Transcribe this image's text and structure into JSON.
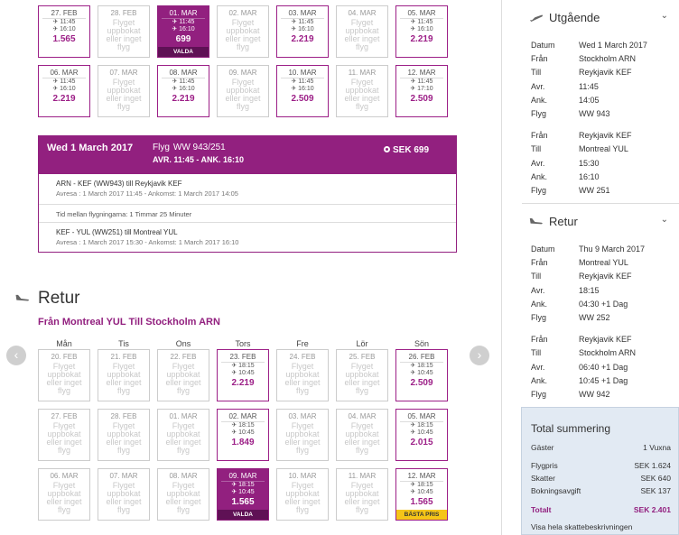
{
  "outbound_calendar": [
    {
      "date": "27. FEB",
      "t1": "11:45",
      "t2": "16:10",
      "price": "1.565",
      "state": "avail"
    },
    {
      "date": "28. FEB",
      "na": [
        "Flyget",
        "uppbokat",
        "eller inget",
        "flyg"
      ],
      "state": "na"
    },
    {
      "date": "01. MAR",
      "t1": "11:45",
      "t2": "16:10",
      "price": "699",
      "state": "sel",
      "tag": "VALDA"
    },
    {
      "date": "02. MAR",
      "na": [
        "Flyget",
        "uppbokat",
        "eller inget",
        "flyg"
      ],
      "state": "na"
    },
    {
      "date": "03. MAR",
      "t1": "11:45",
      "t2": "16:10",
      "price": "2.219",
      "state": "avail"
    },
    {
      "date": "04. MAR",
      "na": [
        "Flyget",
        "uppbokat",
        "eller inget",
        "flyg"
      ],
      "state": "na"
    },
    {
      "date": "05. MAR",
      "t1": "11:45",
      "t2": "16:10",
      "price": "2.219",
      "state": "avail"
    },
    {
      "date": "06. MAR",
      "t1": "11:45",
      "t2": "16:10",
      "price": "2.219",
      "state": "avail"
    },
    {
      "date": "07. MAR",
      "na": [
        "Flyget",
        "uppbokat",
        "eller inget",
        "flyg"
      ],
      "state": "na"
    },
    {
      "date": "08. MAR",
      "t1": "11:45",
      "t2": "16:10",
      "price": "2.219",
      "state": "avail"
    },
    {
      "date": "09. MAR",
      "na": [
        "Flyget",
        "uppbokat",
        "eller inget",
        "flyg"
      ],
      "state": "na"
    },
    {
      "date": "10. MAR",
      "t1": "11:45",
      "t2": "16:10",
      "price": "2.509",
      "state": "avail"
    },
    {
      "date": "11. MAR",
      "na": [
        "Flyget",
        "uppbokat",
        "eller inget",
        "flyg"
      ],
      "state": "na"
    },
    {
      "date": "12. MAR",
      "t1": "11:45",
      "t2": "17:10",
      "price": "2.509",
      "state": "avail"
    }
  ],
  "detail": {
    "date": "Wed 1 March 2017",
    "flyg_label": "Flyg",
    "flight": "WW 943/251",
    "times": "AVR. 11:45 - ANK. 16:10",
    "price": "SEK 699",
    "seg1_title": "ARN - KEF (WW943) till Reykjavik KEF",
    "seg1_times": "Avresa : 1 March 2017 11:45 - Ankomst: 1 March 2017 14:05",
    "gap": "Tid mellan flygningarna: 1 Timmar 25 Minuter",
    "seg2_title": "KEF - YUL (WW251) till Montreal YUL",
    "seg2_times": "Avresa : 1 March 2017 15:30 - Ankomst: 1 March 2017 16:10"
  },
  "retur": {
    "title": "Retur",
    "subtitle": "Från Montreal YUL Till Stockholm ARN",
    "weekdays": [
      "Mån",
      "Tis",
      "Ons",
      "Tors",
      "Fre",
      "Lör",
      "Sön"
    ]
  },
  "return_calendar": [
    {
      "date": "20. FEB",
      "na": [
        "Flyget",
        "uppbokat",
        "eller inget",
        "flyg"
      ],
      "state": "na"
    },
    {
      "date": "21. FEB",
      "na": [
        "Flyget",
        "uppbokat",
        "eller inget",
        "flyg"
      ],
      "state": "na"
    },
    {
      "date": "22. FEB",
      "na": [
        "Flyget",
        "uppbokat",
        "eller inget",
        "flyg"
      ],
      "state": "na"
    },
    {
      "date": "23. FEB",
      "t1": "18:15",
      "t2": "10:45",
      "price": "2.219",
      "state": "avail"
    },
    {
      "date": "24. FEB",
      "na": [
        "Flyget",
        "uppbokat",
        "eller inget",
        "flyg"
      ],
      "state": "na"
    },
    {
      "date": "25. FEB",
      "na": [
        "Flyget",
        "uppbokat",
        "eller inget",
        "flyg"
      ],
      "state": "na"
    },
    {
      "date": "26. FEB",
      "t1": "18:15",
      "t2": "10:45",
      "price": "2.509",
      "state": "avail"
    },
    {
      "date": "27. FEB",
      "na": [
        "Flyget",
        "uppbokat",
        "eller inget",
        "flyg"
      ],
      "state": "na"
    },
    {
      "date": "28. FEB",
      "na": [
        "Flyget",
        "uppbokat",
        "eller inget",
        "flyg"
      ],
      "state": "na"
    },
    {
      "date": "01. MAR",
      "na": [
        "Flyget",
        "uppbokat",
        "eller inget",
        "flyg"
      ],
      "state": "na"
    },
    {
      "date": "02. MAR",
      "t1": "18:15",
      "t2": "10:45",
      "price": "1.849",
      "state": "avail"
    },
    {
      "date": "03. MAR",
      "na": [
        "Flyget",
        "uppbokat",
        "eller inget",
        "flyg"
      ],
      "state": "na"
    },
    {
      "date": "04. MAR",
      "na": [
        "Flyget",
        "uppbokat",
        "eller inget",
        "flyg"
      ],
      "state": "na"
    },
    {
      "date": "05. MAR",
      "t1": "18:15",
      "t2": "10:45",
      "price": "2.015",
      "state": "avail"
    },
    {
      "date": "06. MAR",
      "na": [
        "Flyget",
        "uppbokat",
        "eller inget",
        "flyg"
      ],
      "state": "na"
    },
    {
      "date": "07. MAR",
      "na": [
        "Flyget",
        "uppbokat",
        "eller inget",
        "flyg"
      ],
      "state": "na"
    },
    {
      "date": "08. MAR",
      "na": [
        "Flyget",
        "uppbokat",
        "eller inget",
        "flyg"
      ],
      "state": "na"
    },
    {
      "date": "09. MAR",
      "t1": "18:15",
      "t2": "10:45",
      "price": "1.565",
      "state": "sel",
      "tag": "VALDA"
    },
    {
      "date": "10. MAR",
      "na": [
        "Flyget",
        "uppbokat",
        "eller inget",
        "flyg"
      ],
      "state": "na"
    },
    {
      "date": "11. MAR",
      "na": [
        "Flyget",
        "uppbokat",
        "eller inget",
        "flyg"
      ],
      "state": "na"
    },
    {
      "date": "12. MAR",
      "t1": "18:15",
      "t2": "10:45",
      "price": "1.565",
      "state": "avail",
      "tag": "BÄSTA PRIS",
      "best": true
    }
  ],
  "sidebar": {
    "out_title": "Utgående",
    "out_rows": [
      [
        "Datum",
        "Wed 1 March 2017"
      ],
      [
        "Från",
        "Stockholm ARN"
      ],
      [
        "Till",
        "Reykjavik KEF"
      ],
      [
        "Avr.",
        "11:45"
      ],
      [
        "Ank.",
        "14:05"
      ],
      [
        "Flyg",
        "WW 943"
      ],
      null,
      [
        "Från",
        "Reykjavik KEF"
      ],
      [
        "Till",
        "Montreal YUL"
      ],
      [
        "Avr.",
        "15:30"
      ],
      [
        "Ank.",
        "16:10"
      ],
      [
        "Flyg",
        "WW 251"
      ]
    ],
    "ret_title": "Retur",
    "ret_rows": [
      [
        "Datum",
        "Thu 9 March 2017"
      ],
      [
        "Från",
        "Montreal YUL"
      ],
      [
        "Till",
        "Reykjavik KEF"
      ],
      [
        "Avr.",
        "18:15"
      ],
      [
        "Ank.",
        "04:30 +1 Dag"
      ],
      [
        "Flyg",
        "WW 252"
      ],
      null,
      [
        "Från",
        "Reykjavik KEF"
      ],
      [
        "Till",
        "Stockholm ARN"
      ],
      [
        "Avr.",
        "06:40 +1 Dag"
      ],
      [
        "Ank.",
        "10:45 +1 Dag"
      ],
      [
        "Flyg",
        "WW 942"
      ]
    ]
  },
  "summary": {
    "title": "Total summering",
    "lines": [
      [
        "Gäster",
        "1 Vuxna"
      ],
      [
        "Flygpris",
        "SEK 1.624"
      ],
      [
        "Skatter",
        "SEK 640"
      ],
      [
        "Bokningsavgift",
        "SEK 137"
      ],
      [
        "Totalt",
        "SEK 2.401"
      ]
    ],
    "link": "Visa hela skattebeskrivningen"
  },
  "colors": {
    "brand": "#92207f",
    "best": "#f5c518"
  }
}
